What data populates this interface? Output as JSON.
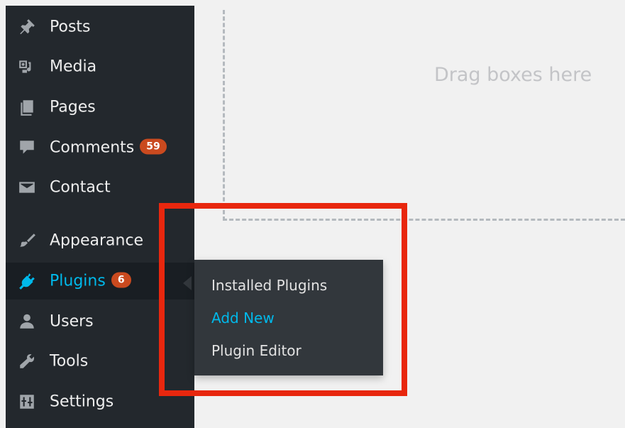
{
  "sidebar": {
    "items": [
      {
        "label": "Posts",
        "icon": "pin-icon"
      },
      {
        "label": "Media",
        "icon": "media-icon"
      },
      {
        "label": "Pages",
        "icon": "pages-icon"
      },
      {
        "label": "Comments",
        "icon": "comment-icon",
        "badge": "59"
      },
      {
        "label": "Contact",
        "icon": "envelope-icon"
      },
      {
        "label": "Appearance",
        "icon": "paintbrush-icon"
      },
      {
        "label": "Plugins",
        "icon": "plugin-icon",
        "badge": "6",
        "active": true
      },
      {
        "label": "Users",
        "icon": "user-icon"
      },
      {
        "label": "Tools",
        "icon": "wrench-icon"
      },
      {
        "label": "Settings",
        "icon": "settings-icon"
      }
    ]
  },
  "submenu": {
    "items": [
      {
        "label": "Installed Plugins"
      },
      {
        "label": "Add New",
        "current": true
      },
      {
        "label": "Plugin Editor"
      }
    ]
  },
  "dropzone": {
    "text": "Drag boxes here"
  },
  "colors": {
    "sidebar_bg": "#23282d",
    "active_accent": "#00b9eb",
    "badge": "#ca4a1f",
    "highlight": "#e8270e"
  }
}
